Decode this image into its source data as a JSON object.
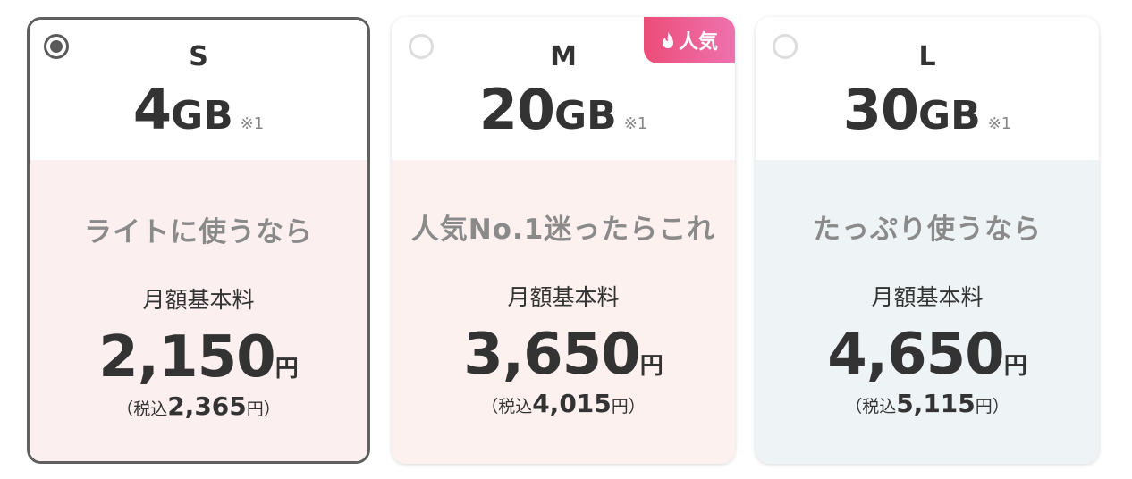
{
  "plans": [
    {
      "size": "S",
      "capacity_value": "4",
      "capacity_unit": "GB",
      "capacity_note": "※1",
      "tagline": "ライトに使うなら",
      "fee_label": "月額基本料",
      "price": "2,150",
      "price_unit": "円",
      "tax_prefix": "（税込",
      "tax_price": "2,365",
      "tax_suffix": "円）",
      "selected": true,
      "badge": null,
      "bottom_color": "#fbefef"
    },
    {
      "size": "M",
      "capacity_value": "20",
      "capacity_unit": "GB",
      "capacity_note": "※1",
      "tagline": "人気No.1迷ったらこれ",
      "fee_label": "月額基本料",
      "price": "3,650",
      "price_unit": "円",
      "tax_prefix": "（税込",
      "tax_price": "4,015",
      "tax_suffix": "円）",
      "selected": false,
      "badge": "人気",
      "bottom_color": "#fcf1ee"
    },
    {
      "size": "L",
      "capacity_value": "30",
      "capacity_unit": "GB",
      "capacity_note": "※1",
      "tagline": "たっぷり使うなら",
      "fee_label": "月額基本料",
      "price": "4,650",
      "price_unit": "円",
      "tax_prefix": "（税込",
      "tax_price": "5,115",
      "tax_suffix": "円）",
      "selected": false,
      "badge": null,
      "bottom_color": "#eef3f5"
    }
  ],
  "badge_icon": "flame-icon",
  "colors": {
    "badge_gradient_start": "#ec4d78",
    "badge_gradient_end": "#ee72ae",
    "selected_border": "#606060"
  }
}
